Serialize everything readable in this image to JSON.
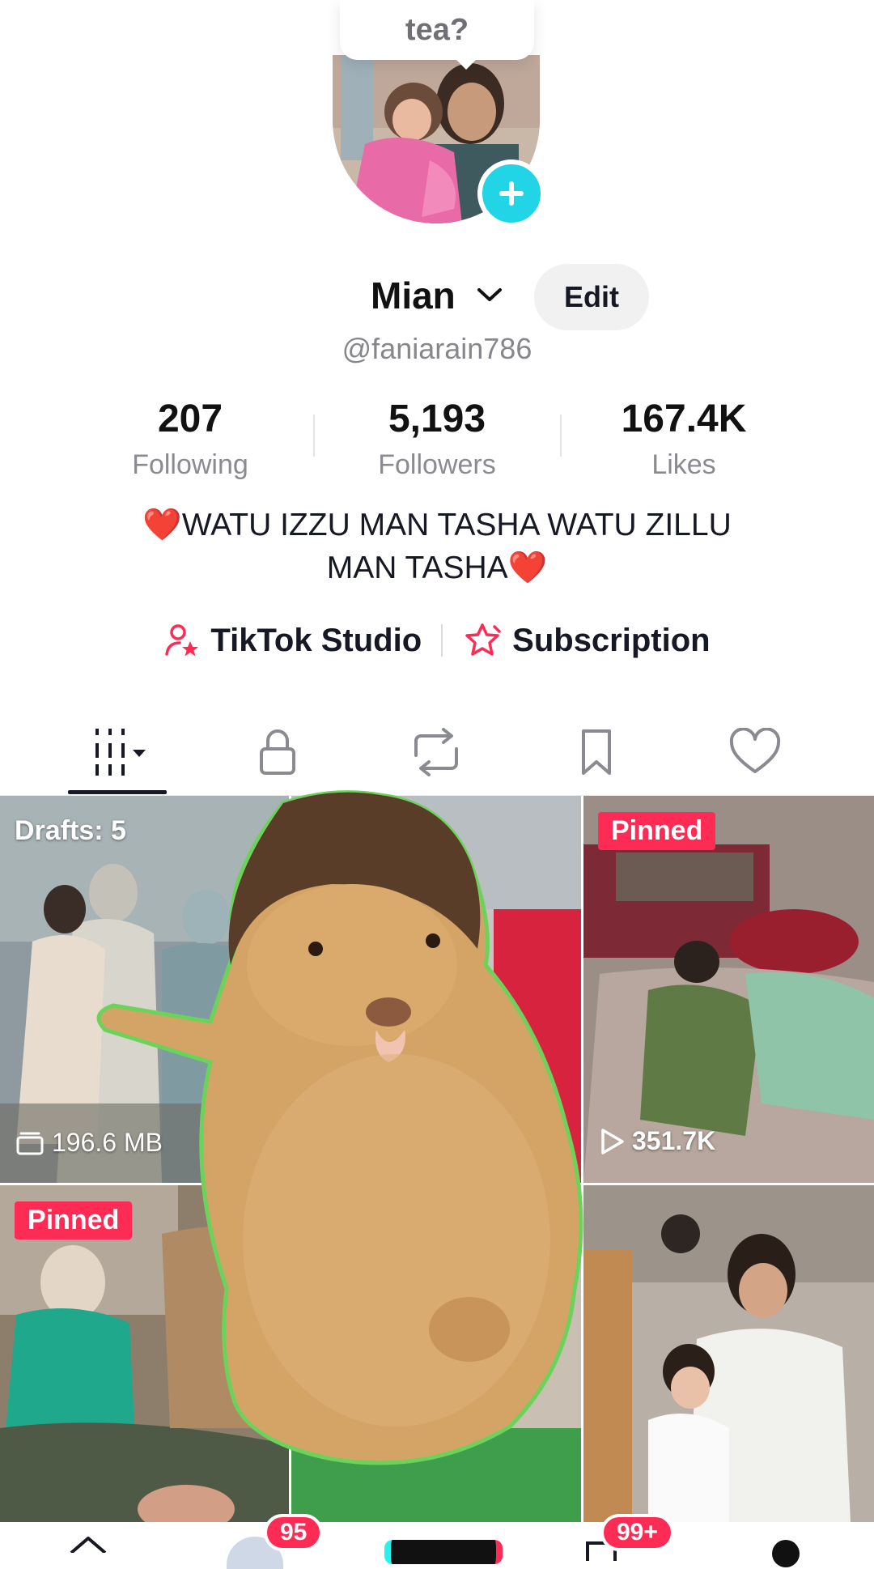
{
  "tooltip": {
    "text": "tea?"
  },
  "profile": {
    "name": "Mian",
    "edit_label": "Edit",
    "handle": "@faniarain786",
    "stats": [
      {
        "value": "207",
        "label": "Following"
      },
      {
        "value": "5,193",
        "label": "Followers"
      },
      {
        "value": "167.4K",
        "label": "Likes"
      }
    ],
    "bio_line1": "WATU IZZU MAN TASHA WATU ZILLU",
    "bio_line2": "MAN TASHA",
    "bio_emoji": "❤️"
  },
  "links": {
    "studio": "TikTok Studio",
    "subscription": "Subscription"
  },
  "tabs": [
    "grid-videos-icon",
    "lock-icon",
    "repost-icon",
    "bookmark-icon",
    "heart-icon"
  ],
  "grid": {
    "drafts_label": "Drafts: 5",
    "drafts_size": "196.6 MB",
    "pinned_label": "Pinned",
    "pinned_views": "351.7K"
  },
  "bottom_nav": {
    "friends_badge": "95",
    "inbox_badge": "99+"
  },
  "colors": {
    "accent": "#fe2c55",
    "add_button": "#21d4e6",
    "text": "#161823",
    "muted": "#8a8b91"
  }
}
